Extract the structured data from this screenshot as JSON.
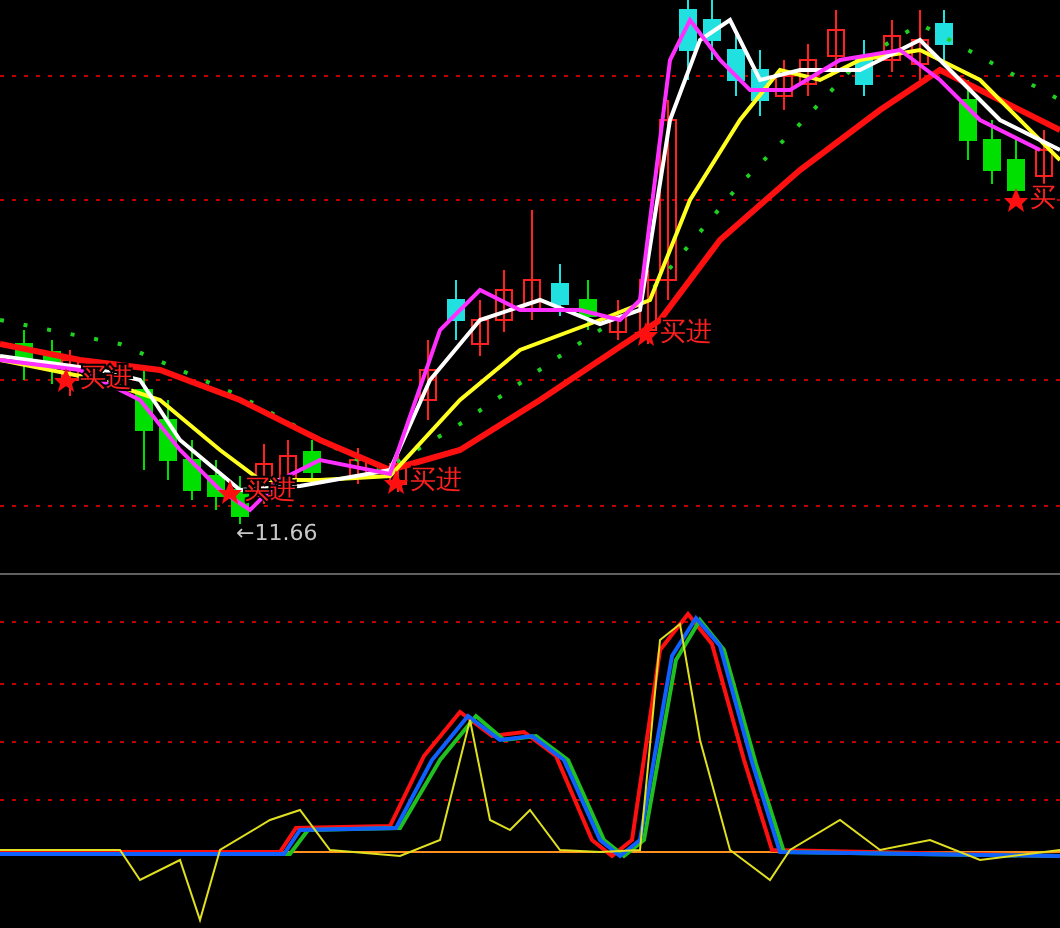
{
  "price_panel": {
    "signals": [
      {
        "label": "买进"
      },
      {
        "label": "买进"
      },
      {
        "label": "买进"
      },
      {
        "label": "买进"
      },
      {
        "label": "买"
      }
    ],
    "low_marker": {
      "label": "←11.66"
    }
  }
}
